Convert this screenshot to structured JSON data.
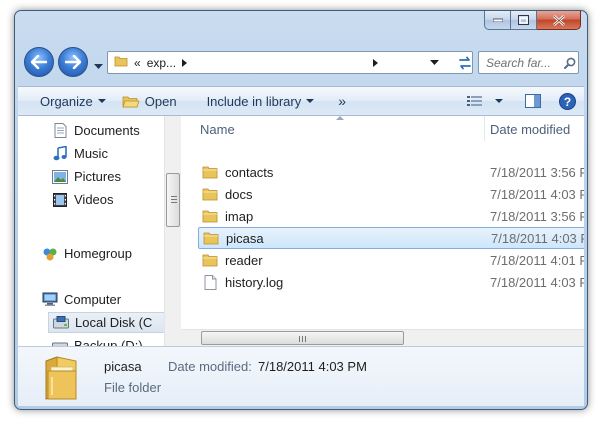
{
  "window": {
    "caption": {
      "minimize": "minimize",
      "maximize": "maximize",
      "close": "close"
    }
  },
  "nav": {
    "address_prefix": "«",
    "address_text": "exp...",
    "search_placeholder": "Search far..."
  },
  "toolbar": {
    "organize_label": "Organize",
    "open_label": "Open",
    "include_label": "Include in library",
    "more_label": "»"
  },
  "sidebar": {
    "items": [
      {
        "label": "Documents",
        "icon": "documents-icon"
      },
      {
        "label": "Music",
        "icon": "music-icon"
      },
      {
        "label": "Pictures",
        "icon": "pictures-icon"
      },
      {
        "label": "Videos",
        "icon": "videos-icon"
      },
      {
        "label": "Homegroup",
        "icon": "homegroup-icon"
      },
      {
        "label": "Computer",
        "icon": "computer-icon"
      },
      {
        "label": "Local Disk (C",
        "icon": "local-disk-icon",
        "selected": true
      },
      {
        "label": "Backup (D:)",
        "icon": "drive-icon"
      }
    ]
  },
  "files": {
    "columns": {
      "name": "Name",
      "date": "Date modified"
    },
    "rows": [
      {
        "name": "contacts",
        "date": "7/18/2011 3:56 P",
        "type": "folder"
      },
      {
        "name": "docs",
        "date": "7/18/2011 4:03 P",
        "type": "folder"
      },
      {
        "name": "imap",
        "date": "7/18/2011 3:56 P",
        "type": "folder"
      },
      {
        "name": "picasa",
        "date": "7/18/2011 4:03 P",
        "type": "folder",
        "selected": true
      },
      {
        "name": "reader",
        "date": "7/18/2011 4:01 P",
        "type": "folder"
      },
      {
        "name": "history.log",
        "date": "7/18/2011 4:03 P",
        "type": "file"
      }
    ]
  },
  "details": {
    "name": "picasa",
    "type": "File folder",
    "date_label": "Date modified:",
    "date_value": "7/18/2011 4:03 PM"
  },
  "colors": {
    "accent": "#3d7fd6",
    "folder": "#e9c45a",
    "selection": "#cde6fc"
  }
}
